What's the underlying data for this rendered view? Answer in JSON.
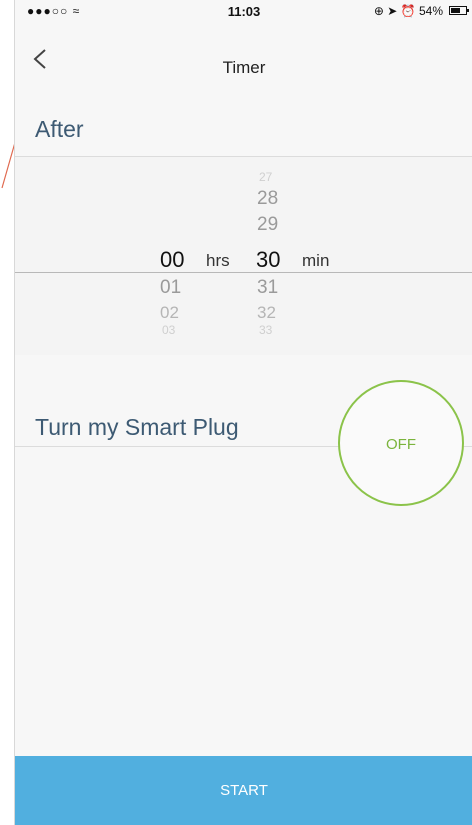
{
  "statusbar": {
    "carrier": "●●●○○ ",
    "time": "11:03",
    "right_icons": "⊕ ➤ ⏰ 54%"
  },
  "nav": {
    "title": "Timer",
    "back_icon": "chevron-left-icon"
  },
  "after": {
    "label": "After"
  },
  "picker": {
    "hours": {
      "selected": "00",
      "unit": "hrs",
      "below": [
        "01",
        "02",
        "03"
      ]
    },
    "minutes": {
      "above": [
        "27",
        "28",
        "29"
      ],
      "selected": "30",
      "unit": "min",
      "below": [
        "31",
        "32",
        "33"
      ]
    }
  },
  "plug": {
    "label": "Turn my Smart Plug",
    "toggle_state": "OFF",
    "accent": "#8bc34a"
  },
  "start": {
    "label": "START",
    "color": "#51afdf"
  }
}
